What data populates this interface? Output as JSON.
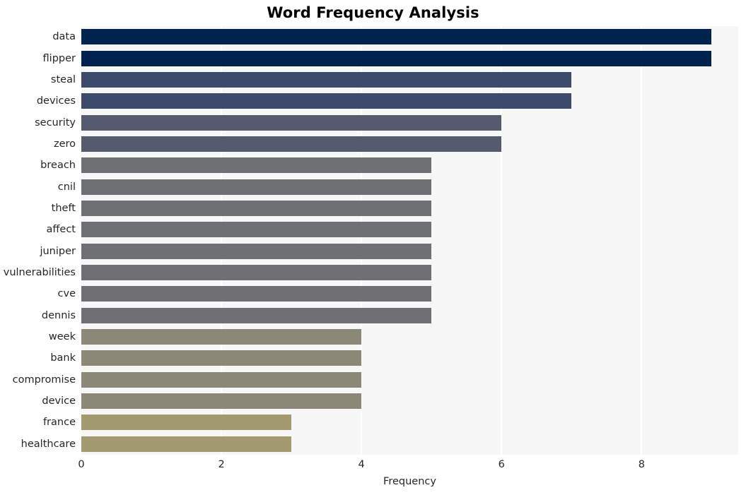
{
  "chart_data": {
    "type": "bar",
    "orientation": "horizontal",
    "title": "Word Frequency Analysis",
    "xlabel": "Frequency",
    "ylabel": "",
    "categories": [
      "data",
      "flipper",
      "steal",
      "devices",
      "security",
      "zero",
      "breach",
      "cnil",
      "theft",
      "affect",
      "juniper",
      "vulnerabilities",
      "cve",
      "dennis",
      "week",
      "bank",
      "compromise",
      "device",
      "france",
      "healthcare"
    ],
    "values": [
      9,
      9,
      7,
      7,
      6,
      6,
      5,
      5,
      5,
      5,
      5,
      5,
      5,
      5,
      4,
      4,
      4,
      4,
      3,
      3
    ],
    "bar_colors": [
      "#00224e",
      "#00224e",
      "#3c4a6b",
      "#3c4a6b",
      "#555b6e",
      "#555b6e",
      "#6e7073",
      "#6e7073",
      "#6e7073",
      "#6e7073",
      "#6e7073",
      "#6e7073",
      "#6e7073",
      "#6e7073",
      "#8b8878",
      "#8b8878",
      "#8b8878",
      "#8b8878",
      "#a39a6f",
      "#a39a6f"
    ],
    "xlim": [
      0,
      9.38
    ],
    "xticks": [
      0,
      2,
      4,
      6,
      8
    ],
    "xtick_labels": [
      "0",
      "2",
      "4",
      "6",
      "8"
    ],
    "grid": "vertical-white",
    "legend": "none",
    "plot_background": "#f7f7f7",
    "figure_background": "#ffffff",
    "title_color": "#000000",
    "tick_label_color": "#262626"
  }
}
